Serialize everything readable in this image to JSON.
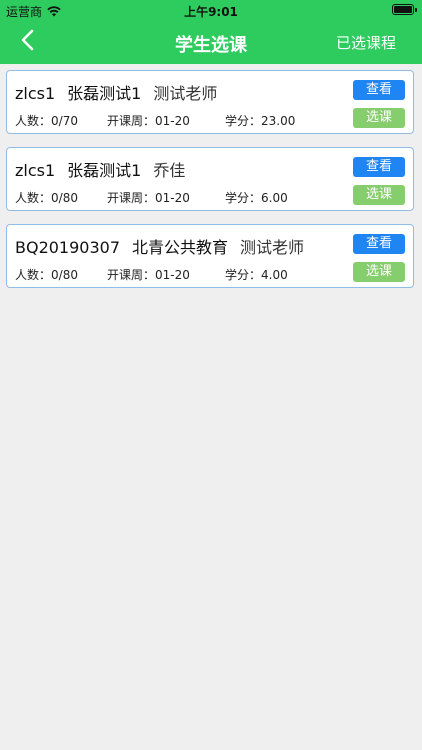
{
  "status_bar": {
    "carrier": "运营商",
    "time": "上午9:01"
  },
  "nav": {
    "title": "学生选课",
    "right_action": "已选课程"
  },
  "labels": {
    "count": "人数：",
    "weeks": "开课周：",
    "credits": "学分：",
    "view": "查看",
    "select": "选课"
  },
  "courses": [
    {
      "code": "zlcs1",
      "name": "张磊测试1",
      "teacher": "测试老师",
      "count": "0/70",
      "weeks": "01-20",
      "credits": "23.00"
    },
    {
      "code": "zlcs1",
      "name": "张磊测试1",
      "teacher": "乔佳",
      "count": "0/80",
      "weeks": "01-20",
      "credits": "6.00"
    },
    {
      "code": "BQ20190307",
      "name": "北青公共教育",
      "teacher": "测试老师",
      "count": "0/80",
      "weeks": "01-20",
      "credits": "4.00"
    }
  ],
  "colors": {
    "header": "#2ecc5f",
    "view_button": "#1e85f2",
    "select_button": "#86cd6d",
    "card_border": "#8fbde6",
    "background": "#efefef"
  }
}
